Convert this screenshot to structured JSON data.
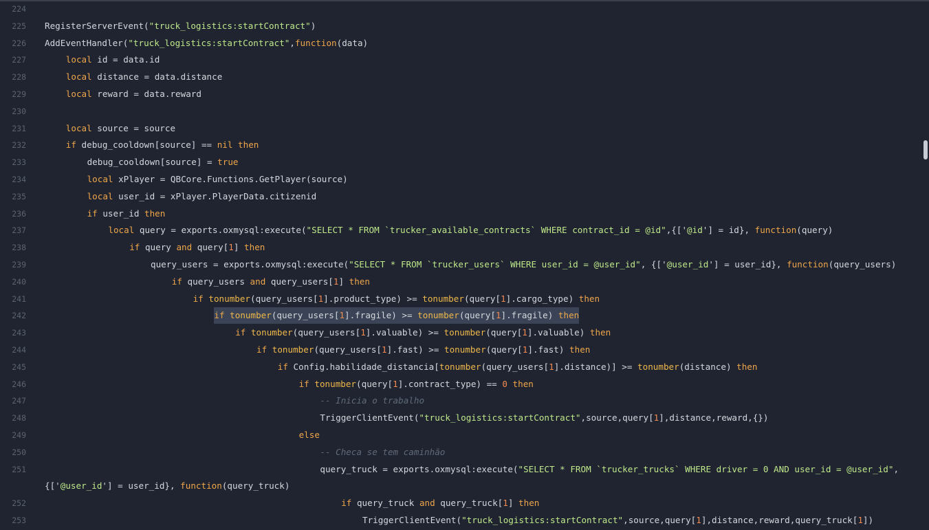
{
  "lines": [
    {
      "n": "224",
      "indent": 0,
      "tokens": []
    },
    {
      "n": "225",
      "indent": 0,
      "tokens": [
        [
          "p",
          "RegisterServerEvent("
        ],
        [
          "s",
          "\"truck_logistics:startContract\""
        ],
        [
          "p",
          ")"
        ]
      ]
    },
    {
      "n": "226",
      "indent": 0,
      "tokens": [
        [
          "p",
          "AddEventHandler("
        ],
        [
          "s",
          "\"truck_logistics:startContract\""
        ],
        [
          "p",
          ","
        ],
        [
          "k",
          "function"
        ],
        [
          "p",
          "(data)"
        ]
      ]
    },
    {
      "n": "227",
      "indent": 1,
      "tokens": [
        [
          "k",
          "local"
        ],
        [
          "p",
          " id = data.id"
        ]
      ]
    },
    {
      "n": "228",
      "indent": 1,
      "tokens": [
        [
          "k",
          "local"
        ],
        [
          "p",
          " distance = data.distance"
        ]
      ]
    },
    {
      "n": "229",
      "indent": 1,
      "tokens": [
        [
          "k",
          "local"
        ],
        [
          "p",
          " reward = data.reward"
        ]
      ]
    },
    {
      "n": "230",
      "indent": 0,
      "tokens": []
    },
    {
      "n": "231",
      "indent": 1,
      "tokens": [
        [
          "k",
          "local"
        ],
        [
          "p",
          " source = source"
        ]
      ]
    },
    {
      "n": "232",
      "indent": 1,
      "tokens": [
        [
          "k",
          "if"
        ],
        [
          "p",
          " debug_cooldown[source] == "
        ],
        [
          "k",
          "nil"
        ],
        [
          "p",
          " "
        ],
        [
          "k",
          "then"
        ]
      ]
    },
    {
      "n": "233",
      "indent": 2,
      "tokens": [
        [
          "p",
          "debug_cooldown[source] = "
        ],
        [
          "k",
          "true"
        ]
      ]
    },
    {
      "n": "234",
      "indent": 2,
      "tokens": [
        [
          "k",
          "local"
        ],
        [
          "p",
          " xPlayer = QBCore.Functions.GetPlayer(source)"
        ]
      ]
    },
    {
      "n": "235",
      "indent": 2,
      "tokens": [
        [
          "k",
          "local"
        ],
        [
          "p",
          " user_id = xPlayer.PlayerData.citizenid"
        ]
      ]
    },
    {
      "n": "236",
      "indent": 2,
      "tokens": [
        [
          "k",
          "if"
        ],
        [
          "p",
          " user_id "
        ],
        [
          "k",
          "then"
        ]
      ]
    },
    {
      "n": "237",
      "indent": 3,
      "tokens": [
        [
          "k",
          "local"
        ],
        [
          "p",
          " query = exports.oxmysql:execute("
        ],
        [
          "s",
          "\"SELECT * FROM `trucker_available_contracts` WHERE contract_id = @id\""
        ],
        [
          "p",
          ",{['"
        ],
        [
          "s",
          "@id"
        ],
        [
          "p",
          "'] = id}, "
        ],
        [
          "k",
          "function"
        ],
        [
          "p",
          "(query)"
        ]
      ]
    },
    {
      "n": "238",
      "indent": 4,
      "tokens": [
        [
          "k",
          "if"
        ],
        [
          "p",
          " query "
        ],
        [
          "k",
          "and"
        ],
        [
          "p",
          " query["
        ],
        [
          "n",
          "1"
        ],
        [
          "p",
          "] "
        ],
        [
          "k",
          "then"
        ]
      ]
    },
    {
      "n": "239",
      "indent": 5,
      "tokens": [
        [
          "p",
          "query_users = exports.oxmysql:execute("
        ],
        [
          "s",
          "\"SELECT * FROM `trucker_users` WHERE user_id = @user_id\""
        ],
        [
          "p",
          ", {['"
        ],
        [
          "s",
          "@user_id"
        ],
        [
          "p",
          "'] = user_id}, "
        ],
        [
          "k",
          "function"
        ],
        [
          "p",
          "(query_users)"
        ]
      ]
    },
    {
      "n": "240",
      "indent": 6,
      "tokens": [
        [
          "k",
          "if"
        ],
        [
          "p",
          " query_users "
        ],
        [
          "k",
          "and"
        ],
        [
          "p",
          " query_users["
        ],
        [
          "n",
          "1"
        ],
        [
          "p",
          "] "
        ],
        [
          "k",
          "then"
        ]
      ]
    },
    {
      "n": "241",
      "indent": 7,
      "tokens": [
        [
          "k",
          "if"
        ],
        [
          "p",
          " "
        ],
        [
          "f",
          "tonumber"
        ],
        [
          "p",
          "(query_users["
        ],
        [
          "n",
          "1"
        ],
        [
          "p",
          "].product_type) >= "
        ],
        [
          "f",
          "tonumber"
        ],
        [
          "p",
          "(query["
        ],
        [
          "n",
          "1"
        ],
        [
          "p",
          "].cargo_type) "
        ],
        [
          "k",
          "then"
        ]
      ]
    },
    {
      "n": "242",
      "indent": 8,
      "highlight": true,
      "tokens": [
        [
          "k",
          "if"
        ],
        [
          "p",
          " "
        ],
        [
          "f",
          "tonumber"
        ],
        [
          "p",
          "(query_users["
        ],
        [
          "n",
          "1"
        ],
        [
          "p",
          "].fragile) >= "
        ],
        [
          "f",
          "tonumber"
        ],
        [
          "p",
          "(query["
        ],
        [
          "n",
          "1"
        ],
        [
          "p",
          "].fragile) "
        ],
        [
          "k",
          "then"
        ]
      ]
    },
    {
      "n": "243",
      "indent": 9,
      "tokens": [
        [
          "k",
          "if"
        ],
        [
          "p",
          " "
        ],
        [
          "f",
          "tonumber"
        ],
        [
          "p",
          "(query_users["
        ],
        [
          "n",
          "1"
        ],
        [
          "p",
          "].valuable) >= "
        ],
        [
          "f",
          "tonumber"
        ],
        [
          "p",
          "(query["
        ],
        [
          "n",
          "1"
        ],
        [
          "p",
          "].valuable) "
        ],
        [
          "k",
          "then"
        ]
      ]
    },
    {
      "n": "244",
      "indent": 10,
      "tokens": [
        [
          "k",
          "if"
        ],
        [
          "p",
          " "
        ],
        [
          "f",
          "tonumber"
        ],
        [
          "p",
          "(query_users["
        ],
        [
          "n",
          "1"
        ],
        [
          "p",
          "].fast) >= "
        ],
        [
          "f",
          "tonumber"
        ],
        [
          "p",
          "(query["
        ],
        [
          "n",
          "1"
        ],
        [
          "p",
          "].fast) "
        ],
        [
          "k",
          "then"
        ]
      ]
    },
    {
      "n": "245",
      "indent": 11,
      "tokens": [
        [
          "k",
          "if"
        ],
        [
          "p",
          " Config.habilidade_distancia["
        ],
        [
          "f",
          "tonumber"
        ],
        [
          "p",
          "(query_users["
        ],
        [
          "n",
          "1"
        ],
        [
          "p",
          "].distance)] >= "
        ],
        [
          "f",
          "tonumber"
        ],
        [
          "p",
          "(distance) "
        ],
        [
          "k",
          "then"
        ]
      ]
    },
    {
      "n": "246",
      "indent": 12,
      "tokens": [
        [
          "k",
          "if"
        ],
        [
          "p",
          " "
        ],
        [
          "f",
          "tonumber"
        ],
        [
          "p",
          "(query["
        ],
        [
          "n",
          "1"
        ],
        [
          "p",
          "].contract_type) == "
        ],
        [
          "n",
          "0"
        ],
        [
          "p",
          " "
        ],
        [
          "k",
          "then"
        ]
      ]
    },
    {
      "n": "247",
      "indent": 13,
      "tokens": [
        [
          "c",
          "-- Inicia o trabalho"
        ]
      ]
    },
    {
      "n": "248",
      "indent": 13,
      "tokens": [
        [
          "p",
          "TriggerClientEvent("
        ],
        [
          "s",
          "\"truck_logistics:startContract\""
        ],
        [
          "p",
          ",source,query["
        ],
        [
          "n",
          "1"
        ],
        [
          "p",
          "],distance,reward,{})"
        ]
      ]
    },
    {
      "n": "249",
      "indent": 12,
      "tokens": [
        [
          "k",
          "else"
        ]
      ]
    },
    {
      "n": "250",
      "indent": 13,
      "tokens": [
        [
          "c",
          "-- Checa se tem caminhão"
        ]
      ]
    },
    {
      "n": "251",
      "indent": 13,
      "tokens": [
        [
          "p",
          "query_truck = exports.oxmysql:execute("
        ],
        [
          "s",
          "\"SELECT * FROM `trucker_trucks` WHERE driver = 0 AND user_id = @user_id\""
        ],
        [
          "p",
          ","
        ]
      ]
    },
    {
      "n": "",
      "indent": 0,
      "tokens": [
        [
          "p",
          "{['"
        ],
        [
          "s",
          "@user_id"
        ],
        [
          "p",
          "'] = user_id}, "
        ],
        [
          "k",
          "function"
        ],
        [
          "p",
          "(query_truck)"
        ]
      ]
    },
    {
      "n": "252",
      "indent": 14,
      "tokens": [
        [
          "k",
          "if"
        ],
        [
          "p",
          " query_truck "
        ],
        [
          "k",
          "and"
        ],
        [
          "p",
          " query_truck["
        ],
        [
          "n",
          "1"
        ],
        [
          "p",
          "] "
        ],
        [
          "k",
          "then"
        ]
      ]
    },
    {
      "n": "253",
      "indent": 15,
      "tokens": [
        [
          "p",
          "TriggerClientEvent("
        ],
        [
          "s",
          "\"truck_logistics:startContract\""
        ],
        [
          "p",
          ",source,query["
        ],
        [
          "n",
          "1"
        ],
        [
          "p",
          "],distance,reward,query_truck["
        ],
        [
          "n",
          "1"
        ],
        [
          "p",
          "])"
        ]
      ]
    }
  ]
}
